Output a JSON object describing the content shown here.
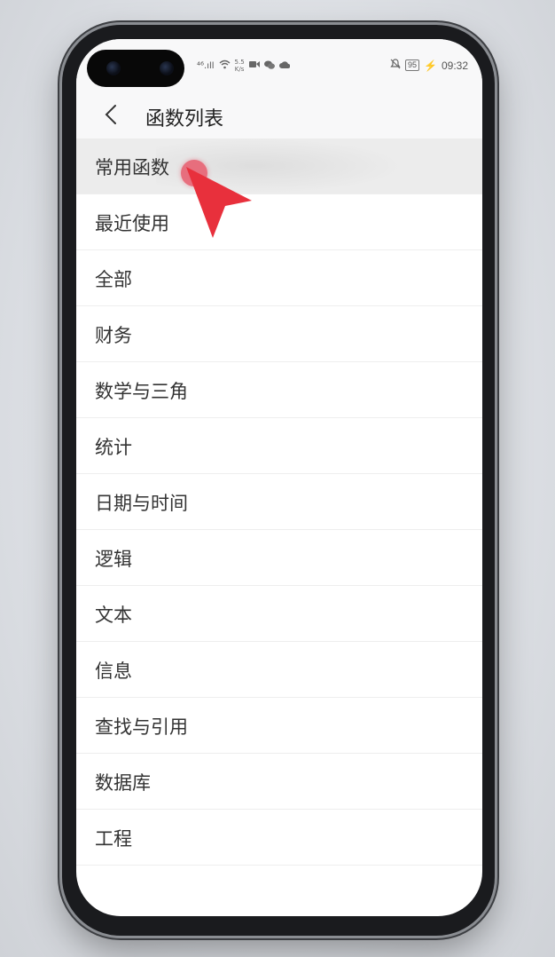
{
  "status_bar": {
    "signal": "⁴⁶.ıll",
    "speed_value": "5.5",
    "speed_unit": "K/s",
    "battery": "95",
    "time": "09:32"
  },
  "header": {
    "title": "函数列表"
  },
  "categories": [
    {
      "label": "常用函数"
    },
    {
      "label": "最近使用"
    },
    {
      "label": "全部"
    },
    {
      "label": "财务"
    },
    {
      "label": "数学与三角"
    },
    {
      "label": "统计"
    },
    {
      "label": "日期与时间"
    },
    {
      "label": "逻辑"
    },
    {
      "label": "文本"
    },
    {
      "label": "信息"
    },
    {
      "label": "查找与引用"
    },
    {
      "label": "数据库"
    },
    {
      "label": "工程"
    }
  ],
  "colors": {
    "pointer": "#e8303c",
    "accent": "#222222"
  }
}
